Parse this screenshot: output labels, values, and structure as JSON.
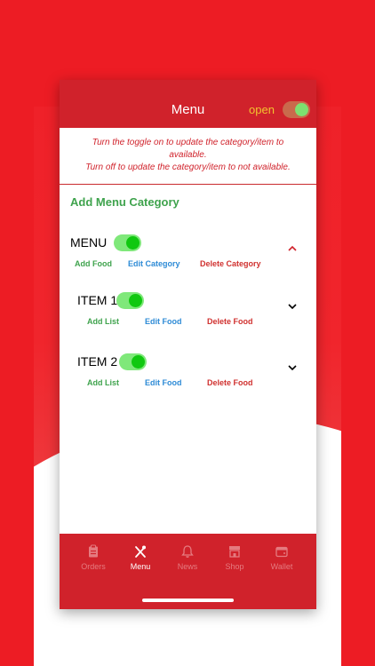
{
  "header": {
    "title": "Menu",
    "status_label": "open",
    "toggle_on": true
  },
  "notice": {
    "line1": "Turn the toggle on to update the category/item to",
    "line2": "available.",
    "line3": "Turn off to update the category/item to not available."
  },
  "add_category_label": "Add Menu Category",
  "category": {
    "name": "MENU",
    "enabled": true,
    "add_label": "Add Food",
    "edit_label": "Edit Category",
    "delete_label": "Delete Category",
    "expanded": true
  },
  "items": [
    {
      "name": "ITEM 1",
      "enabled": true,
      "add_label": "Add List",
      "edit_label": "Edit Food",
      "delete_label": "Delete Food"
    },
    {
      "name": "ITEM 2",
      "enabled": true,
      "add_label": "Add List",
      "edit_label": "Edit Food",
      "delete_label": "Delete Food"
    }
  ],
  "tabs": [
    {
      "label": "Orders",
      "icon": "clipboard-icon",
      "active": false
    },
    {
      "label": "Menu",
      "icon": "utensils-icon",
      "active": true
    },
    {
      "label": "News",
      "icon": "bell-icon",
      "active": false
    },
    {
      "label": "Shop",
      "icon": "store-icon",
      "active": false
    },
    {
      "label": "Wallet",
      "icon": "wallet-icon",
      "active": false
    }
  ],
  "colors": {
    "brand_red": "#d0222b",
    "background_red": "#ed1c24",
    "accent_green": "#3fa34d",
    "link_blue": "#2e8bd6",
    "status_yellow": "#f2c32f"
  }
}
